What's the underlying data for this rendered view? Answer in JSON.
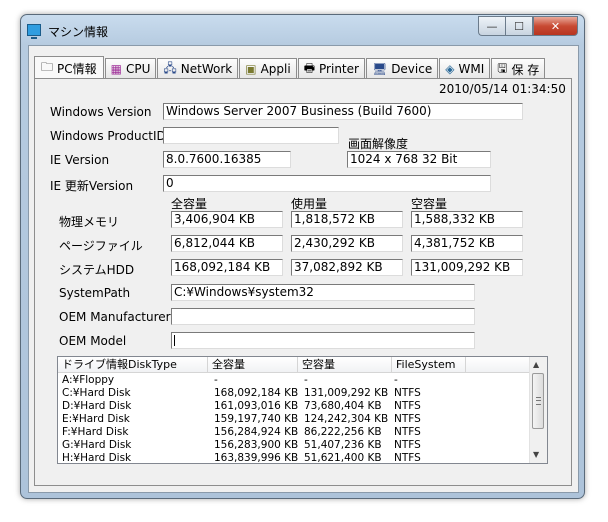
{
  "window": {
    "title": "マシン情報",
    "minimize": "—",
    "maximize": "☐",
    "close": "✕"
  },
  "tabs": [
    {
      "label": "PC情報",
      "icon": "folder-icon",
      "glyph": "🗀"
    },
    {
      "label": "CPU",
      "icon": "chip-icon",
      "glyph": "▦"
    },
    {
      "label": "NetWork",
      "icon": "network-icon",
      "glyph": "🖧"
    },
    {
      "label": "Appli",
      "icon": "app-icon",
      "glyph": "▣"
    },
    {
      "label": "Printer",
      "icon": "printer-icon",
      "glyph": "🖶"
    },
    {
      "label": "Device",
      "icon": "device-icon",
      "glyph": "🖥"
    },
    {
      "label": "WMI",
      "icon": "wmi-icon",
      "glyph": "◈"
    },
    {
      "label": "保 存",
      "icon": "save-icon",
      "glyph": "🖫"
    }
  ],
  "timestamp": "2010/05/14 01:34:50",
  "fields": {
    "windows_version": {
      "label": "Windows Version",
      "value": "Windows Server 2007 Business (Build 7600)"
    },
    "product_id": {
      "label": "Windows ProductID",
      "value": ""
    },
    "resolution": {
      "label": "画面解像度",
      "value": "1024 x 768 32 Bit"
    },
    "ie_version": {
      "label": "IE Version",
      "value": "8.0.7600.16385"
    },
    "ie_update": {
      "label": "IE 更新Version",
      "value": "0"
    }
  },
  "capacity": {
    "headers": {
      "total": "全容量",
      "used": "使用量",
      "free": "空容量"
    },
    "rows": [
      {
        "label": "物理メモリ",
        "total": "3,406,904 KB",
        "used": "1,818,572 KB",
        "free": "1,588,332 KB"
      },
      {
        "label": "ページファイル",
        "total": "6,812,044 KB",
        "used": "2,430,292 KB",
        "free": "4,381,752 KB"
      },
      {
        "label": "システムHDD",
        "total": "168,092,184 KB",
        "used": "37,082,892 KB",
        "free": "131,009,292 KB"
      }
    ]
  },
  "system_path": {
    "label": "SystemPath",
    "value": "C:¥Windows¥system32"
  },
  "oem_manufacturer": {
    "label": "OEM Manufacturer",
    "value": ""
  },
  "oem_model": {
    "label": "OEM Model",
    "value": ""
  },
  "drive_list": {
    "columns": [
      "ドライブ情報DiskType",
      "全容量",
      "空容量",
      "FileSystem"
    ],
    "rows": [
      [
        "A:¥Floppy",
        "-",
        "-",
        "-"
      ],
      [
        "C:¥Hard Disk",
        "168,092,184 KB",
        "131,009,292 KB",
        "NTFS"
      ],
      [
        "D:¥Hard Disk",
        "161,093,016 KB",
        "73,680,404 KB",
        "NTFS"
      ],
      [
        "E:¥Hard Disk",
        "159,197,740 KB",
        "124,242,304 KB",
        "NTFS"
      ],
      [
        "F:¥Hard Disk",
        "156,284,924 KB",
        "86,222,256 KB",
        "NTFS"
      ],
      [
        "G:¥Hard Disk",
        "156,283,900 KB",
        "51,407,236 KB",
        "NTFS"
      ],
      [
        "H:¥Hard Disk",
        "163,839,996 KB",
        "51,621,400 KB",
        "NTFS"
      ]
    ]
  }
}
